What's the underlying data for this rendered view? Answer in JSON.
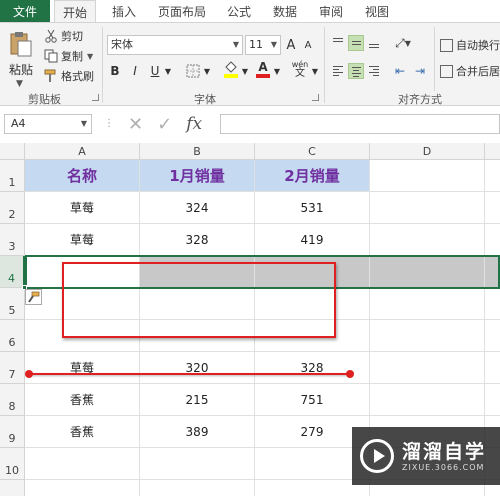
{
  "ribbon": {
    "tabs": [
      {
        "label": "文件",
        "active": false
      },
      {
        "label": "开始",
        "active": true
      },
      {
        "label": "插入",
        "active": false
      },
      {
        "label": "页面布局",
        "active": false
      },
      {
        "label": "公式",
        "active": false
      },
      {
        "label": "数据",
        "active": false
      },
      {
        "label": "审阅",
        "active": false
      },
      {
        "label": "视图",
        "active": false
      }
    ],
    "clipboard": {
      "paste_label": "粘贴",
      "cut_label": "剪切",
      "copy_label": "复制",
      "format_painter_label": "格式刷",
      "group_label": "剪贴板"
    },
    "font": {
      "font_name": "宋体",
      "font_size": "11",
      "bold": "B",
      "italic": "I",
      "underline": "U",
      "grow": "A",
      "shrink": "A",
      "font_color_letter": "A",
      "phonetic": "wén",
      "group_label": "字体",
      "font_color": "#e02020",
      "fill_color": "#ffff00"
    },
    "alignment": {
      "wrap_label": "自动换行",
      "merge_label": "合并后居",
      "group_label": "对齐方式"
    }
  },
  "formula_bar": {
    "name_box": "A4",
    "fx_label": "fx",
    "formula": ""
  },
  "sheet": {
    "columns": [
      "A",
      "B",
      "C",
      "D"
    ],
    "rows": [
      "1",
      "2",
      "3",
      "4",
      "5",
      "6",
      "7",
      "8",
      "9",
      "10"
    ],
    "selected_row": "4",
    "header": [
      "名称",
      "1月销量",
      "2月销量"
    ],
    "data": [
      {
        "row": "2",
        "name": "草莓",
        "jan": "324",
        "feb": "531"
      },
      {
        "row": "3",
        "name": "草莓",
        "jan": "328",
        "feb": "419"
      },
      {
        "row": "7",
        "name": "草莓",
        "jan": "320",
        "feb": "328"
      },
      {
        "row": "8",
        "name": "香蕉",
        "jan": "215",
        "feb": "751"
      },
      {
        "row": "9",
        "name": "香蕉",
        "jan": "389",
        "feb": "279"
      }
    ],
    "header_fill": "#c5d9f1",
    "header_text_color": "#7030a0",
    "annotation_color": "#e02020"
  },
  "watermark": {
    "title": "溜溜自学",
    "url": "ZIXUE.3066.COM"
  }
}
